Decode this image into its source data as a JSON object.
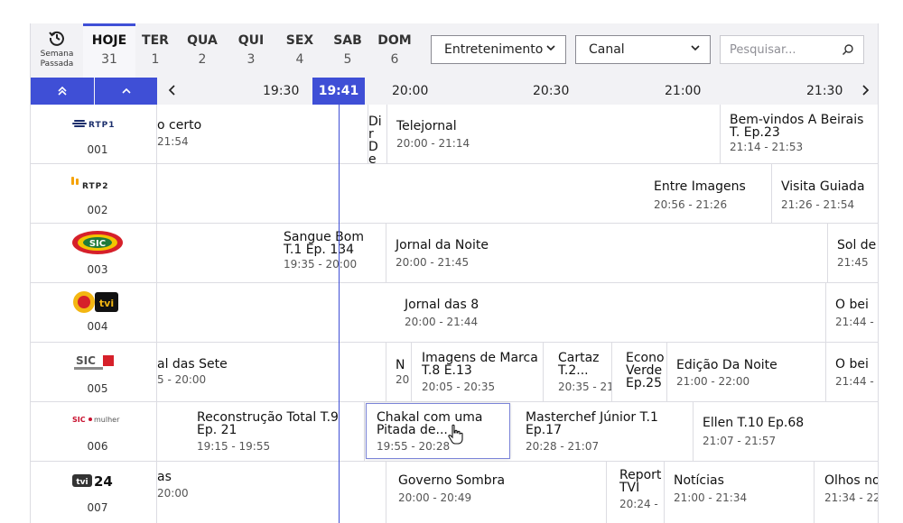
{
  "header": {
    "week_back": {
      "icon": "history-icon",
      "label": "Semana Passada"
    },
    "days": [
      {
        "name": "HOJE",
        "date": "31",
        "active": true
      },
      {
        "name": "TER",
        "date": "1"
      },
      {
        "name": "QUA",
        "date": "2"
      },
      {
        "name": "QUI",
        "date": "3"
      },
      {
        "name": "SEX",
        "date": "4"
      },
      {
        "name": "SAB",
        "date": "5"
      },
      {
        "name": "DOM",
        "date": "6"
      }
    ],
    "genre_select": "Entretenimento",
    "channel_select": "Canal",
    "search_placeholder": "Pesquisar..."
  },
  "timebar": {
    "times": [
      "19:30",
      "20:00",
      "20:30",
      "21:00",
      "21:30"
    ],
    "now": "19:41"
  },
  "colors": {
    "accent": "#3f4fd6",
    "bar_bg": "#f2f2f5",
    "divider": "#dcdce2"
  },
  "channels": [
    {
      "number": "001",
      "logo": "rtp1-logo",
      "programs": [
        {
          "title": "o certo",
          "time": "21:54"
        },
        {
          "title": "Dir De An",
          "time": ""
        },
        {
          "title": "Telejornal",
          "time": "20:00 - 21:14"
        },
        {
          "title": "Bem-vindos A Beirais T. Ep.23",
          "time": "21:14 - 21:53"
        }
      ]
    },
    {
      "number": "002",
      "logo": "rtp2-logo",
      "programs": [
        {
          "title": "Entre Imagens",
          "time": "20:56 - 21:26"
        },
        {
          "title": "Visita Guiada",
          "time": "21:26 - 21:54"
        }
      ]
    },
    {
      "number": "003",
      "logo": "sic-logo",
      "programs": [
        {
          "title": "Sangue Bom T.1 Ep. 134",
          "time": "19:35 - 20:00"
        },
        {
          "title": "Jornal da Noite",
          "time": "20:00 - 21:45"
        },
        {
          "title": "Sol de",
          "time": "21:45"
        }
      ]
    },
    {
      "number": "004",
      "logo": "tvi-logo",
      "programs": [
        {
          "title": "Jornal das 8",
          "time": "20:00 - 21:44"
        },
        {
          "title": "O bei",
          "time": "21:44 -"
        }
      ]
    },
    {
      "number": "005",
      "logo": "sic-noticias-logo",
      "programs": [
        {
          "title": "al das Sete",
          "time": "5 - 20:00"
        },
        {
          "title": "N",
          "time": "20"
        },
        {
          "title": "Imagens de Marca T.8 E.13",
          "time": "20:05 - 20:35"
        },
        {
          "title": "Cartaz T.2...",
          "time": "20:35 - 21:"
        },
        {
          "title": "Econo Verde Ep.25",
          "time": ""
        },
        {
          "title": "Edição Da Noite",
          "time": "21:00 - 22:00"
        },
        {
          "title": "O bei",
          "time": "21:44 -"
        }
      ]
    },
    {
      "number": "006",
      "logo": "sic-mulher-logo",
      "programs": [
        {
          "title": "Reconstrução Total T.9 Ep. 21",
          "time": "19:15 - 19:55"
        },
        {
          "title": "Chakal com uma Pitada de...",
          "time": "19:55 - 20:28"
        },
        {
          "title": "Masterchef Júnior T.1 Ep.17",
          "time": "20:28 - 21:07"
        },
        {
          "title": "Ellen T.10 Ep.68",
          "time": "21:07 - 21:57"
        }
      ]
    },
    {
      "number": "007",
      "logo": "tvi24-logo",
      "programs": [
        {
          "title": "as",
          "time": "20:00"
        },
        {
          "title": "Governo Sombra",
          "time": "20:00 - 20:49"
        },
        {
          "title": "Report TVI",
          "time": "20:24 -"
        },
        {
          "title": "Notícias",
          "time": "21:00 - 21:34"
        },
        {
          "title": "Olhos no",
          "time": "21:34 - 22:"
        }
      ]
    }
  ]
}
